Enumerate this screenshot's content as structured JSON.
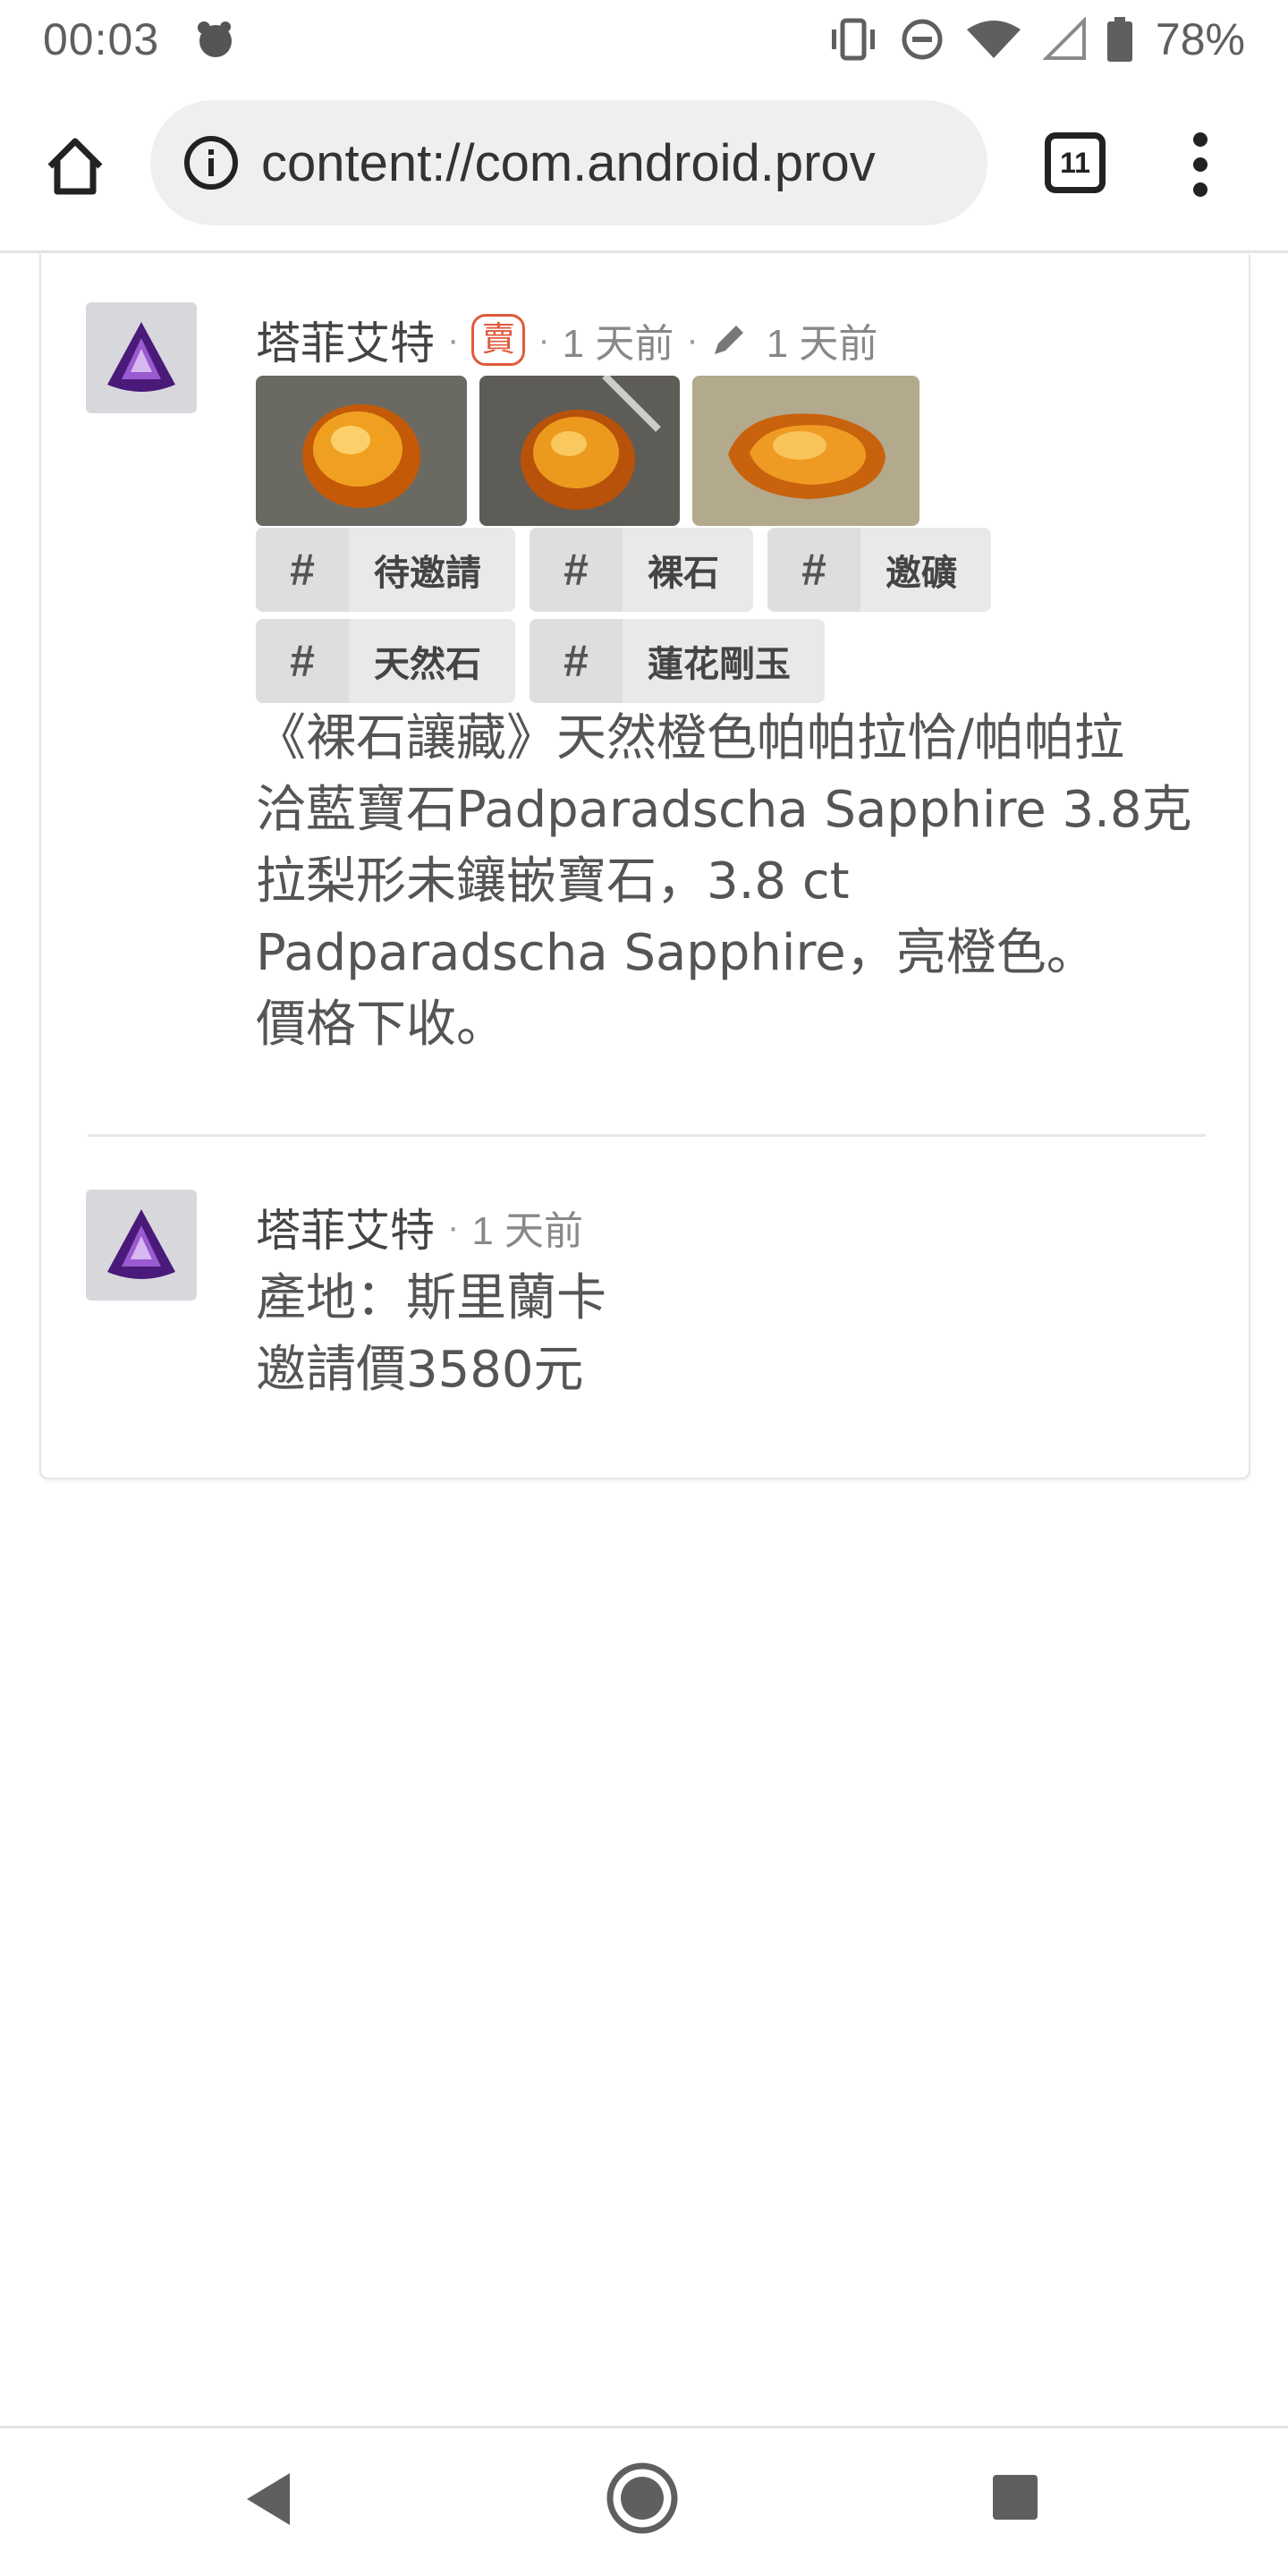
{
  "status_bar": {
    "time": "00:03",
    "battery": "78%"
  },
  "browser": {
    "url": "content://com.android.prov",
    "tab_count": "11"
  },
  "post": {
    "author": "塔菲艾特",
    "badge": "賣",
    "posted": "1 天前",
    "edited": "1 天前",
    "images": [
      "orange-pear-gem-1",
      "orange-pear-gem-2",
      "orange-pear-gem-3"
    ],
    "tags": [
      "待邀請",
      "裸石",
      "邀礦",
      "天然石",
      "蓮花剛玉"
    ],
    "body": "《裸石讓藏》天然橙色帕帕拉恰/帕帕拉\n洽藍寶石Padparadscha Sapphire 3.8克\n拉梨形未鑲嵌寶石，3.8 ct\nPadparadscha Sapphire，亮橙色。\n價格下收。"
  },
  "reply": {
    "author": "塔菲艾特",
    "posted": "1 天前",
    "body": "產地：斯里蘭卡\n邀請價3580元"
  },
  "colors": {
    "badge": "#e05a3a",
    "gem_orange": "#e08a1a",
    "avatar_gem": "#4a1a7a"
  }
}
